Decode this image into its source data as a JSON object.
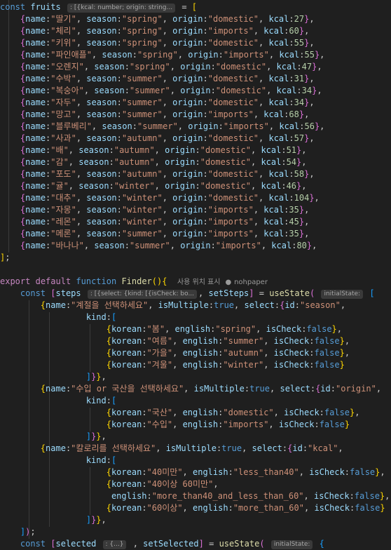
{
  "editor": {
    "hints": {
      "fruits_type": ": [{kcal: number; origin: string...",
      "steps_type": ": [{select: {kind: [{isCheck: bo...",
      "usestate_param": "initialState:",
      "selected_type": ": {...}"
    },
    "codelens": {
      "show_usages": "사용 위치 표시",
      "author": "nohpaper"
    },
    "fruits": [
      {
        "name": "딸기",
        "season": "spring",
        "origin": "domestic",
        "kcal": "27"
      },
      {
        "name": "체리",
        "season": "spring",
        "origin": "imports",
        "kcal": "60"
      },
      {
        "name": "키위",
        "season": "spring",
        "origin": "domestic",
        "kcal": "55"
      },
      {
        "name": "파인애플",
        "season": "spring",
        "origin": "imports",
        "kcal": "55"
      },
      {
        "name": "오렌지",
        "season": "spring",
        "origin": "domestic",
        "kcal": "47"
      },
      {
        "name": "수박",
        "season": "summer",
        "origin": "domestic",
        "kcal": "31"
      },
      {
        "name": "복숭아",
        "season": "summer",
        "origin": "domestic",
        "kcal": "34"
      },
      {
        "name": "자두",
        "season": "summer",
        "origin": "domestic",
        "kcal": "34"
      },
      {
        "name": "망고",
        "season": "summer",
        "origin": "imports",
        "kcal": "68"
      },
      {
        "name": "블루베리",
        "season": "summer",
        "origin": "imports",
        "kcal": "56"
      },
      {
        "name": "사과",
        "season": "autumn",
        "origin": "domestic",
        "kcal": "57"
      },
      {
        "name": "배",
        "season": "autumn",
        "origin": "domestic",
        "kcal": "51"
      },
      {
        "name": "감",
        "season": "autumn",
        "origin": "domestic",
        "kcal": "54"
      },
      {
        "name": "포도",
        "season": "autumn",
        "origin": "domestic",
        "kcal": "58"
      },
      {
        "name": "귤",
        "season": "winter",
        "origin": "domestic",
        "kcal": "46"
      },
      {
        "name": "대추",
        "season": "winter",
        "origin": "domestic",
        "kcal": "104"
      },
      {
        "name": "자몽",
        "season": "winter",
        "origin": "imports",
        "kcal": "35"
      },
      {
        "name": "레몬",
        "season": "winter",
        "origin": "imports",
        "kcal": "45"
      },
      {
        "name": "메론",
        "season": "summer",
        "origin": "imports",
        "kcal": "35"
      },
      {
        "name": "바나나",
        "season": "summer",
        "origin": "imports",
        "kcal": "80"
      }
    ],
    "steps": [
      {
        "name": "계절을 선택하세요",
        "select_id": "season",
        "kinds": [
          {
            "korean": "봄",
            "english": "spring"
          },
          {
            "korean": "여름",
            "english": "summer"
          },
          {
            "korean": "가을",
            "english": "autumn"
          },
          {
            "korean": "겨울",
            "english": "winter"
          }
        ]
      },
      {
        "name": "수입 or 국산을 선택하세요",
        "select_id": "origin",
        "kinds": [
          {
            "korean": "국산",
            "english": "domestic"
          },
          {
            "korean": "수입",
            "english": "imports"
          }
        ]
      },
      {
        "name": "칼로리를 선택하세요",
        "select_id": "kcal",
        "kinds": [
          {
            "korean": "40미만",
            "english": "less_than40"
          },
          {
            "korean": "40이상 60미만",
            "english": "more_than40_and_less_than_60"
          },
          {
            "korean": "60이상",
            "english": "more_than_60"
          }
        ]
      }
    ]
  }
}
